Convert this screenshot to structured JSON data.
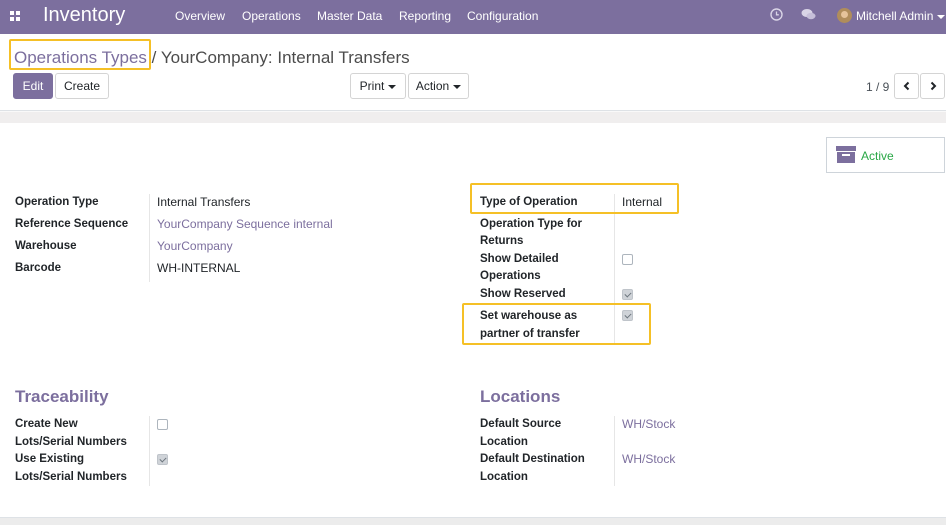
{
  "navbar": {
    "app_title": "Inventory",
    "menu": [
      "Overview",
      "Operations",
      "Master Data",
      "Reporting",
      "Configuration"
    ],
    "user": "Mitchell Admin",
    "icons": [
      "apps-grid-icon",
      "clock-icon",
      "chat-icon",
      "avatar"
    ]
  },
  "breadcrumb": {
    "parent": "Operations Types",
    "separator": "/",
    "current": "YourCompany: Internal Transfers"
  },
  "toolbar": {
    "edit": "Edit",
    "create": "Create",
    "print": "Print",
    "action": "Action"
  },
  "pager": {
    "value": "1 / 9"
  },
  "status": {
    "active": "Active"
  },
  "general": {
    "operation_type_label": "Operation Type",
    "operation_type_value": "Internal Transfers",
    "reference_sequence_label": "Reference Sequence",
    "reference_sequence_value": "YourCompany Sequence internal",
    "warehouse_label": "Warehouse",
    "warehouse_value": "YourCompany",
    "barcode_label": "Barcode",
    "barcode_value": "WH-INTERNAL"
  },
  "operation": {
    "type_label": "Type of Operation",
    "type_value": "Internal",
    "returns_label_1": "Operation Type for",
    "returns_label_2": "Returns",
    "detailed_label_1": "Show Detailed",
    "detailed_label_2": "Operations",
    "detailed_checked": false,
    "reserved_label": "Show Reserved",
    "reserved_checked": true,
    "partner_label_1": "Set warehouse as",
    "partner_label_2": "partner of transfer",
    "partner_checked": true
  },
  "traceability": {
    "title": "Traceability",
    "create_new_label_1": "Create New",
    "create_new_label_2": "Lots/Serial Numbers",
    "create_new_checked": false,
    "use_existing_label_1": "Use Existing",
    "use_existing_label_2": "Lots/Serial Numbers",
    "use_existing_checked": true
  },
  "locations": {
    "title": "Locations",
    "source_label_1": "Default Source",
    "source_label_2": "Location",
    "source_value": "WH/Stock",
    "destination_label_1": "Default Destination",
    "destination_label_2": "Location",
    "destination_value": "WH/Stock"
  },
  "colors": {
    "brand": "#7c6f9e",
    "highlight": "#f5c026",
    "active": "#28a745"
  }
}
